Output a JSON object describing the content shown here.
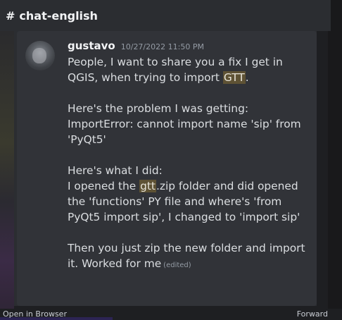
{
  "channel": {
    "hash": "#",
    "name": "chat-english"
  },
  "message": {
    "author": "gustavo",
    "timestamp": "10/27/2022 11:50 PM",
    "p1": {
      "a": "People, I want to share you a fix I get in QGIS, when trying to import ",
      "hl": "GTT",
      "b": "."
    },
    "p2": {
      "line1": "Here's the problem I was getting:",
      "line2": "ImportError: cannot import name 'sip' from 'PyQt5'"
    },
    "p3": {
      "line1": "Here's what I did:",
      "a": "I opened the ",
      "hl": "gtt",
      "b": ".zip folder and did opened the 'functions' PY file and where's 'from PyQt5 import sip', I changed to 'import sip'"
    },
    "p4": {
      "text": "Then you just zip the new folder and import it. Worked for me",
      "edited": "(edited)"
    }
  },
  "footer": {
    "open_in_browser": "Open in Browser",
    "forward": "Forward"
  },
  "colors": {
    "background": "#1e1f22",
    "card": "#313338",
    "highlight": "#5e5234"
  }
}
